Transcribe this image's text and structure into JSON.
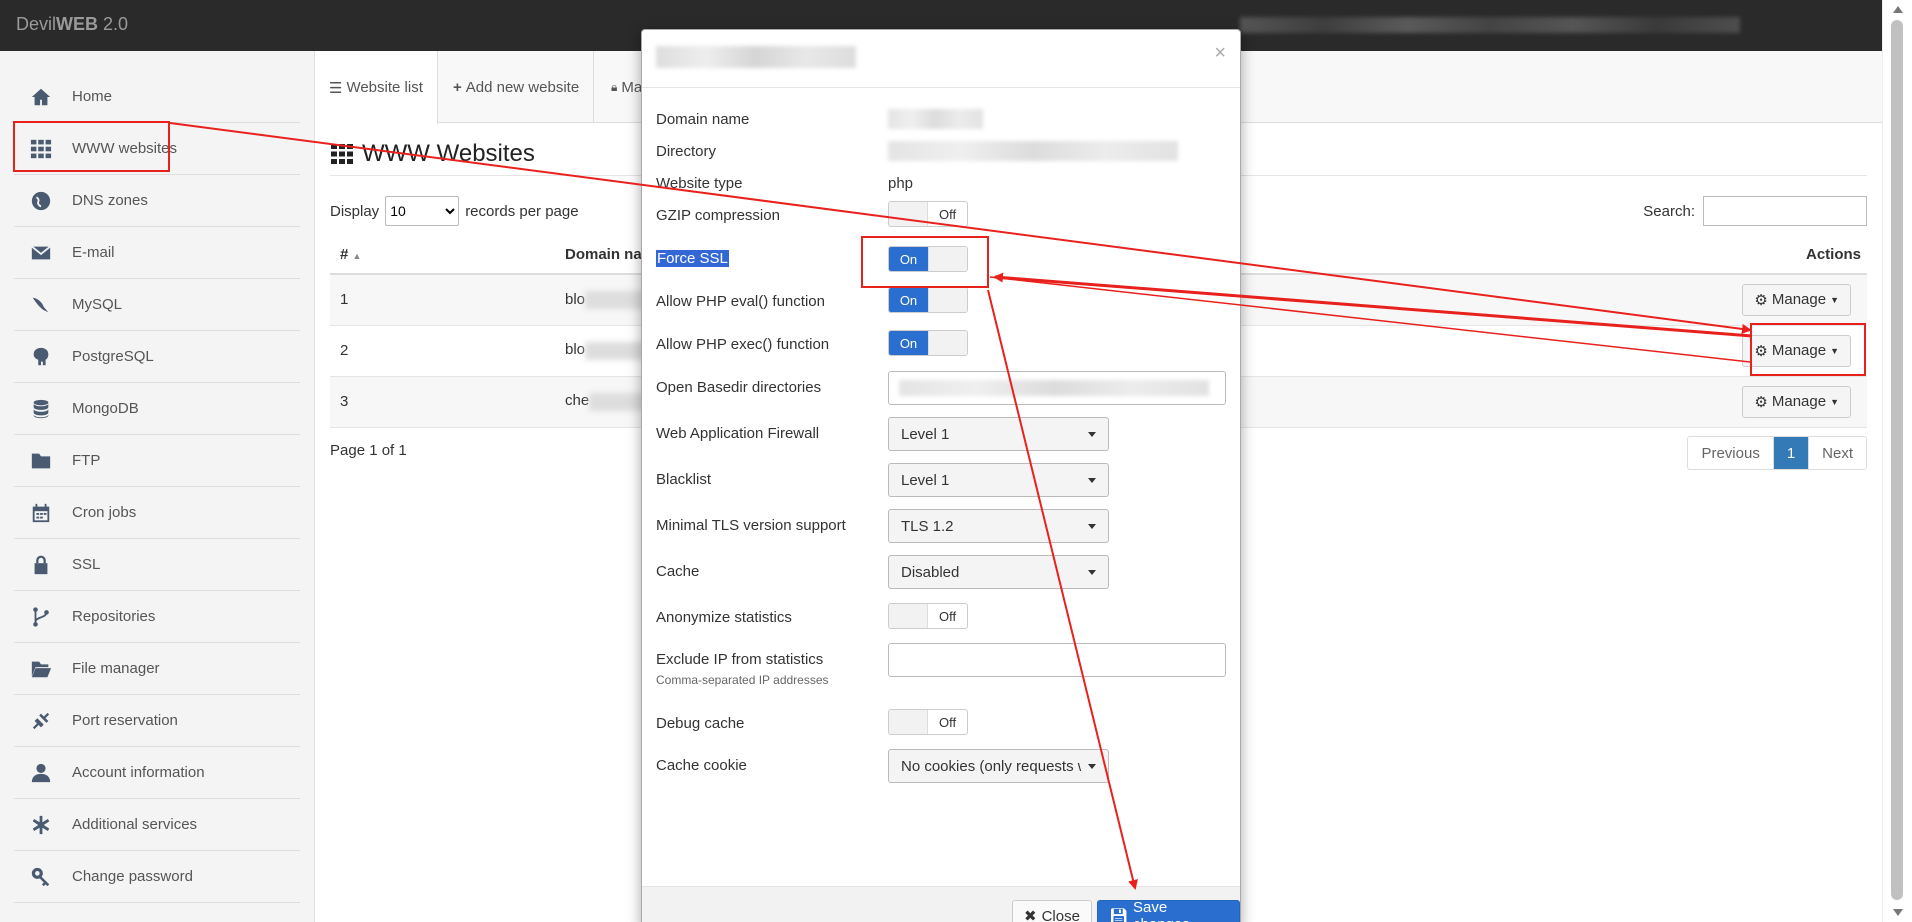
{
  "app": {
    "brand_light": "Devil",
    "brand_bold": "WEB",
    "brand_version": " 2.0"
  },
  "sidebar": {
    "items": [
      {
        "label": "Home",
        "icon": "home-icon"
      },
      {
        "label": "WWW websites",
        "icon": "grid-icon"
      },
      {
        "label": "DNS zones",
        "icon": "globe-icon"
      },
      {
        "label": "E-mail",
        "icon": "envelope-icon"
      },
      {
        "label": "MySQL",
        "icon": "dolphin-icon"
      },
      {
        "label": "PostgreSQL",
        "icon": "elephant-icon"
      },
      {
        "label": "MongoDB",
        "icon": "database-icon"
      },
      {
        "label": "FTP",
        "icon": "folder-icon"
      },
      {
        "label": "Cron jobs",
        "icon": "calendar-icon"
      },
      {
        "label": "SSL",
        "icon": "lock-icon"
      },
      {
        "label": "Repositories",
        "icon": "branch-icon"
      },
      {
        "label": "File manager",
        "icon": "folder-open-icon"
      },
      {
        "label": "Port reservation",
        "icon": "plug-icon"
      },
      {
        "label": "Account information",
        "icon": "user-icon"
      },
      {
        "label": "Additional services",
        "icon": "asterisk-icon"
      },
      {
        "label": "Change password",
        "icon": "key-icon"
      }
    ]
  },
  "tabs": {
    "list": "Website list",
    "add": "Add new website",
    "third": "Ma"
  },
  "main": {
    "title": "WWW Websites",
    "display_label": "Display",
    "display_value": "10",
    "records_label": "records per page",
    "search_label": "Search:",
    "columns": {
      "num": "#",
      "domain": "Domain nar",
      "actions": "Actions"
    },
    "rows": [
      {
        "num": "1",
        "domain": "blo"
      },
      {
        "num": "2",
        "domain": "blo"
      },
      {
        "num": "3",
        "domain": "che"
      }
    ],
    "manage_label": "Manage",
    "page_info": "Page 1 of 1",
    "pager": {
      "prev": "Previous",
      "current": "1",
      "next": "Next"
    }
  },
  "modal": {
    "close_x": "×",
    "fields": {
      "domain_name": "Domain name",
      "directory": "Directory",
      "website_type": "Website type",
      "website_type_value": "php",
      "gzip": "GZIP compression",
      "force_ssl": "Force SSL",
      "php_eval": "Allow PHP eval() function",
      "php_exec": "Allow PHP exec() function",
      "open_basedir": "Open Basedir directories",
      "waf": "Web Application Firewall",
      "waf_value": "Level 1",
      "blacklist": "Blacklist",
      "blacklist_value": "Level 1",
      "tls": "Minimal TLS version support",
      "tls_value": "TLS 1.2",
      "cache": "Cache",
      "cache_value": "Disabled",
      "anonymize": "Anonymize statistics",
      "exclude_ip": "Exclude IP from statistics",
      "exclude_ip_hint": "Comma-separated IP addresses",
      "debug_cache": "Debug cache",
      "cache_cookie": "Cache cookie",
      "cache_cookie_value": "No cookies (only requests w"
    },
    "toggle_on": "On",
    "toggle_off": "Off",
    "close_button": "Close",
    "save_button": "Save changes"
  },
  "colors": {
    "annotation": "#e8211d",
    "accent": "#2a6fcf"
  }
}
